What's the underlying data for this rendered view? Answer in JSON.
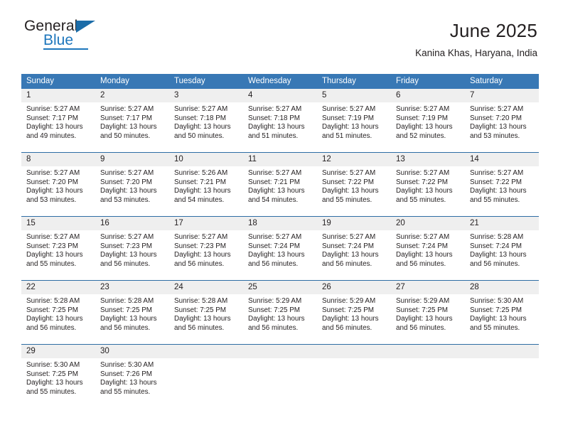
{
  "brand": {
    "name_part1": "General",
    "name_part2": "Blue",
    "logo_icon": "triangle-icon"
  },
  "header": {
    "title": "June 2025",
    "location": "Kanina Khas, Haryana, India"
  },
  "calendar": {
    "weekday_headers": [
      "Sunday",
      "Monday",
      "Tuesday",
      "Wednesday",
      "Thursday",
      "Friday",
      "Saturday"
    ],
    "accent_color": "#3878b5",
    "grid_line_color": "#2e6da4",
    "daynum_band_color": "#efefef",
    "weeks": [
      [
        {
          "day": "1",
          "sunrise": "Sunrise: 5:27 AM",
          "sunset": "Sunset: 7:17 PM",
          "daylight": "Daylight: 13 hours and 49 minutes."
        },
        {
          "day": "2",
          "sunrise": "Sunrise: 5:27 AM",
          "sunset": "Sunset: 7:17 PM",
          "daylight": "Daylight: 13 hours and 50 minutes."
        },
        {
          "day": "3",
          "sunrise": "Sunrise: 5:27 AM",
          "sunset": "Sunset: 7:18 PM",
          "daylight": "Daylight: 13 hours and 50 minutes."
        },
        {
          "day": "4",
          "sunrise": "Sunrise: 5:27 AM",
          "sunset": "Sunset: 7:18 PM",
          "daylight": "Daylight: 13 hours and 51 minutes."
        },
        {
          "day": "5",
          "sunrise": "Sunrise: 5:27 AM",
          "sunset": "Sunset: 7:19 PM",
          "daylight": "Daylight: 13 hours and 51 minutes."
        },
        {
          "day": "6",
          "sunrise": "Sunrise: 5:27 AM",
          "sunset": "Sunset: 7:19 PM",
          "daylight": "Daylight: 13 hours and 52 minutes."
        },
        {
          "day": "7",
          "sunrise": "Sunrise: 5:27 AM",
          "sunset": "Sunset: 7:20 PM",
          "daylight": "Daylight: 13 hours and 53 minutes."
        }
      ],
      [
        {
          "day": "8",
          "sunrise": "Sunrise: 5:27 AM",
          "sunset": "Sunset: 7:20 PM",
          "daylight": "Daylight: 13 hours and 53 minutes."
        },
        {
          "day": "9",
          "sunrise": "Sunrise: 5:27 AM",
          "sunset": "Sunset: 7:20 PM",
          "daylight": "Daylight: 13 hours and 53 minutes."
        },
        {
          "day": "10",
          "sunrise": "Sunrise: 5:26 AM",
          "sunset": "Sunset: 7:21 PM",
          "daylight": "Daylight: 13 hours and 54 minutes."
        },
        {
          "day": "11",
          "sunrise": "Sunrise: 5:27 AM",
          "sunset": "Sunset: 7:21 PM",
          "daylight": "Daylight: 13 hours and 54 minutes."
        },
        {
          "day": "12",
          "sunrise": "Sunrise: 5:27 AM",
          "sunset": "Sunset: 7:22 PM",
          "daylight": "Daylight: 13 hours and 55 minutes."
        },
        {
          "day": "13",
          "sunrise": "Sunrise: 5:27 AM",
          "sunset": "Sunset: 7:22 PM",
          "daylight": "Daylight: 13 hours and 55 minutes."
        },
        {
          "day": "14",
          "sunrise": "Sunrise: 5:27 AM",
          "sunset": "Sunset: 7:22 PM",
          "daylight": "Daylight: 13 hours and 55 minutes."
        }
      ],
      [
        {
          "day": "15",
          "sunrise": "Sunrise: 5:27 AM",
          "sunset": "Sunset: 7:23 PM",
          "daylight": "Daylight: 13 hours and 55 minutes."
        },
        {
          "day": "16",
          "sunrise": "Sunrise: 5:27 AM",
          "sunset": "Sunset: 7:23 PM",
          "daylight": "Daylight: 13 hours and 56 minutes."
        },
        {
          "day": "17",
          "sunrise": "Sunrise: 5:27 AM",
          "sunset": "Sunset: 7:23 PM",
          "daylight": "Daylight: 13 hours and 56 minutes."
        },
        {
          "day": "18",
          "sunrise": "Sunrise: 5:27 AM",
          "sunset": "Sunset: 7:24 PM",
          "daylight": "Daylight: 13 hours and 56 minutes."
        },
        {
          "day": "19",
          "sunrise": "Sunrise: 5:27 AM",
          "sunset": "Sunset: 7:24 PM",
          "daylight": "Daylight: 13 hours and 56 minutes."
        },
        {
          "day": "20",
          "sunrise": "Sunrise: 5:27 AM",
          "sunset": "Sunset: 7:24 PM",
          "daylight": "Daylight: 13 hours and 56 minutes."
        },
        {
          "day": "21",
          "sunrise": "Sunrise: 5:28 AM",
          "sunset": "Sunset: 7:24 PM",
          "daylight": "Daylight: 13 hours and 56 minutes."
        }
      ],
      [
        {
          "day": "22",
          "sunrise": "Sunrise: 5:28 AM",
          "sunset": "Sunset: 7:25 PM",
          "daylight": "Daylight: 13 hours and 56 minutes."
        },
        {
          "day": "23",
          "sunrise": "Sunrise: 5:28 AM",
          "sunset": "Sunset: 7:25 PM",
          "daylight": "Daylight: 13 hours and 56 minutes."
        },
        {
          "day": "24",
          "sunrise": "Sunrise: 5:28 AM",
          "sunset": "Sunset: 7:25 PM",
          "daylight": "Daylight: 13 hours and 56 minutes."
        },
        {
          "day": "25",
          "sunrise": "Sunrise: 5:29 AM",
          "sunset": "Sunset: 7:25 PM",
          "daylight": "Daylight: 13 hours and 56 minutes."
        },
        {
          "day": "26",
          "sunrise": "Sunrise: 5:29 AM",
          "sunset": "Sunset: 7:25 PM",
          "daylight": "Daylight: 13 hours and 56 minutes."
        },
        {
          "day": "27",
          "sunrise": "Sunrise: 5:29 AM",
          "sunset": "Sunset: 7:25 PM",
          "daylight": "Daylight: 13 hours and 56 minutes."
        },
        {
          "day": "28",
          "sunrise": "Sunrise: 5:30 AM",
          "sunset": "Sunset: 7:25 PM",
          "daylight": "Daylight: 13 hours and 55 minutes."
        }
      ],
      [
        {
          "day": "29",
          "sunrise": "Sunrise: 5:30 AM",
          "sunset": "Sunset: 7:25 PM",
          "daylight": "Daylight: 13 hours and 55 minutes."
        },
        {
          "day": "30",
          "sunrise": "Sunrise: 5:30 AM",
          "sunset": "Sunset: 7:26 PM",
          "daylight": "Daylight: 13 hours and 55 minutes."
        },
        null,
        null,
        null,
        null,
        null
      ]
    ]
  }
}
